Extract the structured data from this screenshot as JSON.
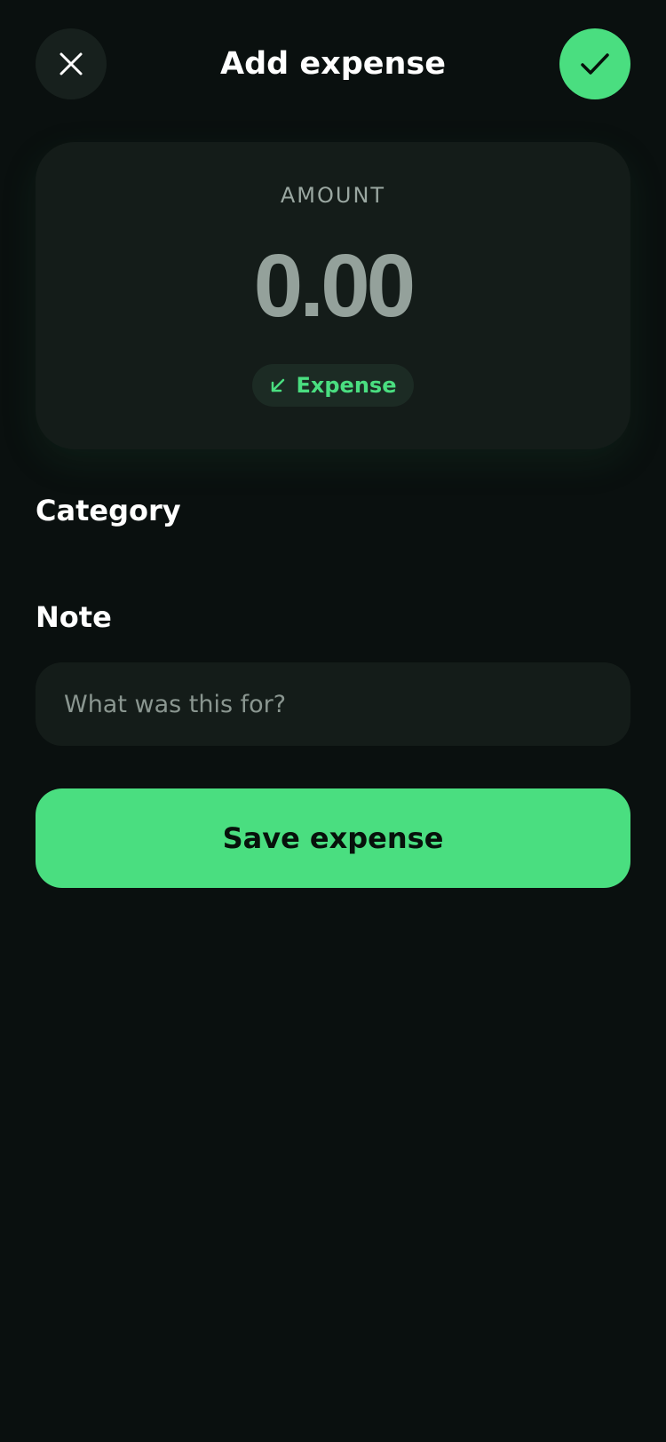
{
  "header": {
    "title": "Add expense",
    "close_icon": "close-icon",
    "confirm_icon": "check-icon"
  },
  "amount_card": {
    "label": "AMOUNT",
    "value": "0.00",
    "type_label": "Expense",
    "type_icon": "arrow-down-left-icon"
  },
  "category": {
    "title": "Category"
  },
  "note": {
    "title": "Note",
    "placeholder": "What was this for?",
    "value": ""
  },
  "save_button": {
    "label": "Save expense"
  },
  "colors": {
    "background": "#0a100f",
    "surface": "#141c19",
    "accent": "#4ade80",
    "muted_text": "#9aa7a1"
  }
}
